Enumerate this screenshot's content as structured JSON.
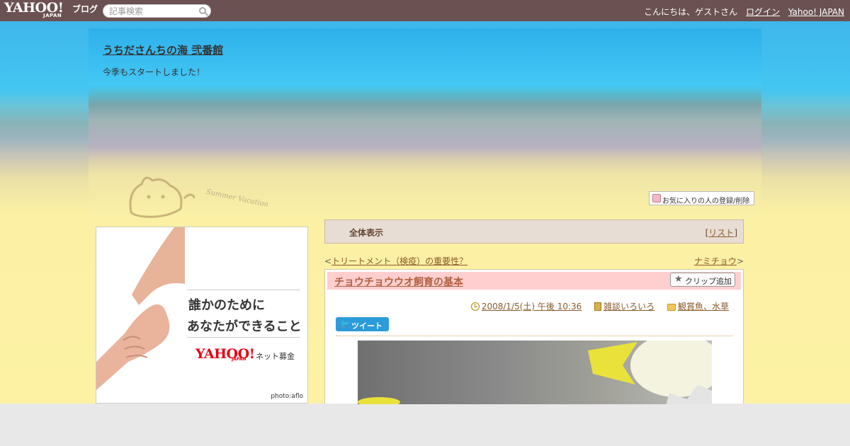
{
  "topbar": {
    "logo_brand": "YAHOO!",
    "logo_japan": "JAPAN",
    "logo_blog": "ブログ",
    "search_placeholder": "記事検索",
    "greeting": "こんにちは、ゲストさん",
    "login": "ログイン",
    "yahoo_japan": "Yahoo! JAPAN"
  },
  "header": {
    "blog_title": "うちださんちの海 弐番館",
    "blog_description": "今季もスタートしました！",
    "sand_text": "Summer Vacation",
    "favorite_button": "お気に入りの人の登録/削除"
  },
  "ad": {
    "line1": "誰かのために",
    "line2": "あなたができること",
    "logo": "YAHOO!",
    "logo_sub": "JAPAN",
    "net": "ネット募金",
    "photo_credit": "photo:aflo"
  },
  "tabs": {
    "all": "全体表示",
    "list_open": "[",
    "list": "リスト",
    "list_close": "]"
  },
  "nav": {
    "prev_arrow": "<",
    "prev": "トリートメント（検疫）の重要性？",
    "next": "ナミチョウ",
    "next_arrow": ">"
  },
  "article": {
    "title": "チョウチョウウオ飼育の基本",
    "clip_button": "クリップ追加",
    "date": "2008/1/5(土) 午後 10:36",
    "category1": "雑談いろいろ",
    "category2": "観賞魚、水草",
    "tweet": "ツイート"
  },
  "colors": {
    "topbar": "#6b5151",
    "title_band": "#ffcfcf",
    "tab_bg": "#e8ddd4",
    "link": "#8a5a2a",
    "tweet": "#2b9bd9"
  }
}
